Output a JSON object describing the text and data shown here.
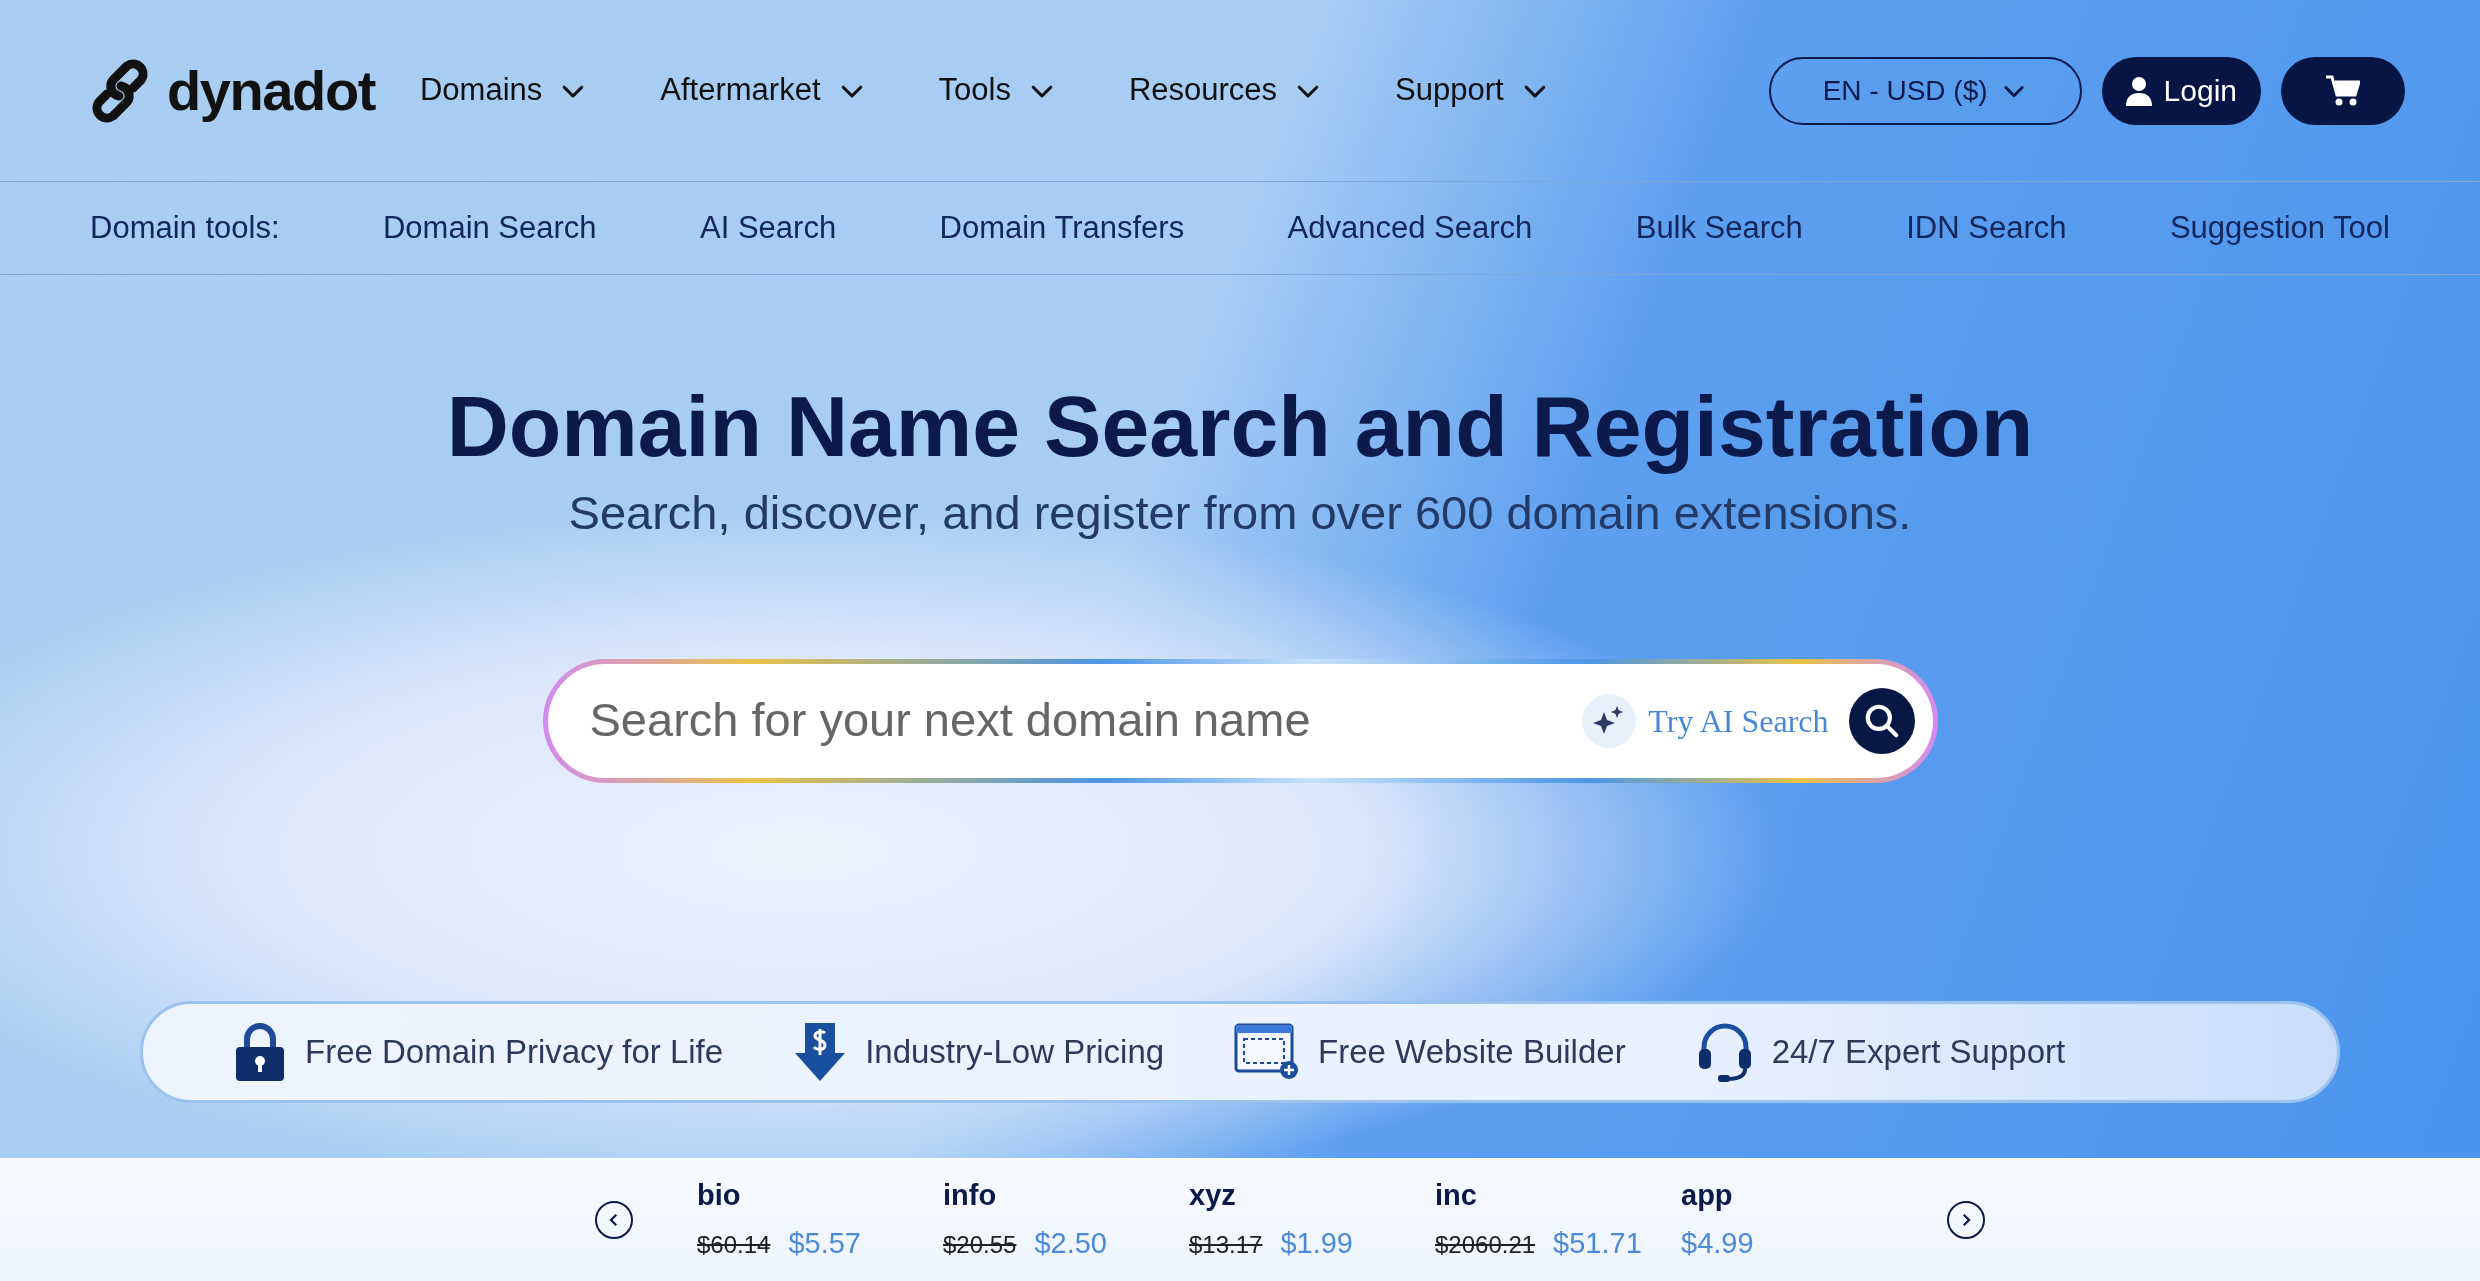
{
  "logo": {
    "text": "dynadot"
  },
  "nav": [
    {
      "label": "Domains"
    },
    {
      "label": "Aftermarket"
    },
    {
      "label": "Tools"
    },
    {
      "label": "Resources"
    },
    {
      "label": "Support"
    }
  ],
  "locale": "EN - USD ($)",
  "login": "Login",
  "domain_tools": {
    "label": "Domain tools:",
    "items": [
      "Domain Search",
      "AI Search",
      "Domain Transfers",
      "Advanced Search",
      "Bulk Search",
      "IDN Search",
      "Suggestion Tool"
    ]
  },
  "hero": {
    "title": "Domain Name Search and Registration",
    "subtitle": "Search, discover, and register from over 600 domain extensions."
  },
  "search": {
    "placeholder": "Search for your next domain name",
    "ai_link": "Try AI Search"
  },
  "features": [
    {
      "kind": "lock",
      "text": "Free Domain Privacy for Life"
    },
    {
      "kind": "price",
      "text": "Industry-Low Pricing"
    },
    {
      "kind": "builder",
      "text": "Free Website Builder"
    },
    {
      "kind": "support",
      "text": "24/7 Expert Support"
    }
  ],
  "tlds": [
    {
      "name": "bio",
      "old_price": "$60.14",
      "price": "$5.57"
    },
    {
      "name": "info",
      "old_price": "$20.55",
      "price": "$2.50"
    },
    {
      "name": "xyz",
      "old_price": "$13.17",
      "price": "$1.99"
    },
    {
      "name": "inc",
      "old_price": "$2060.21",
      "price": "$51.71"
    },
    {
      "name": "app",
      "price": "$4.99"
    }
  ]
}
